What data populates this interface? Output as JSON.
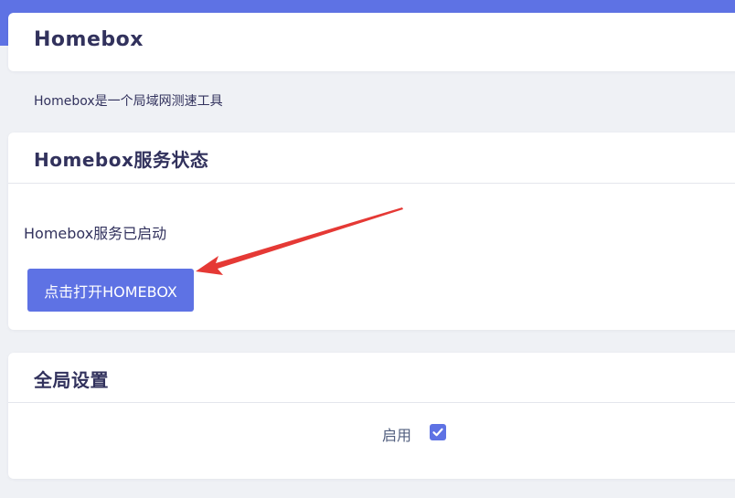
{
  "page": {
    "title": "Homebox",
    "description": "Homebox是一个局域网测速工具"
  },
  "status_section": {
    "title": "Homebox服务状态",
    "status_text": "Homebox服务已启动",
    "open_button_label": "点击打开HOMEBOX"
  },
  "settings_section": {
    "title": "全局设置",
    "enable_label": "启用",
    "enable_checked": true
  },
  "icons": {
    "checkbox": "check-icon",
    "annotation": "red-arrow-annotation"
  },
  "colors": {
    "accent": "#5e72e4",
    "annotation": "#e53935",
    "background": "#eff1f5"
  }
}
